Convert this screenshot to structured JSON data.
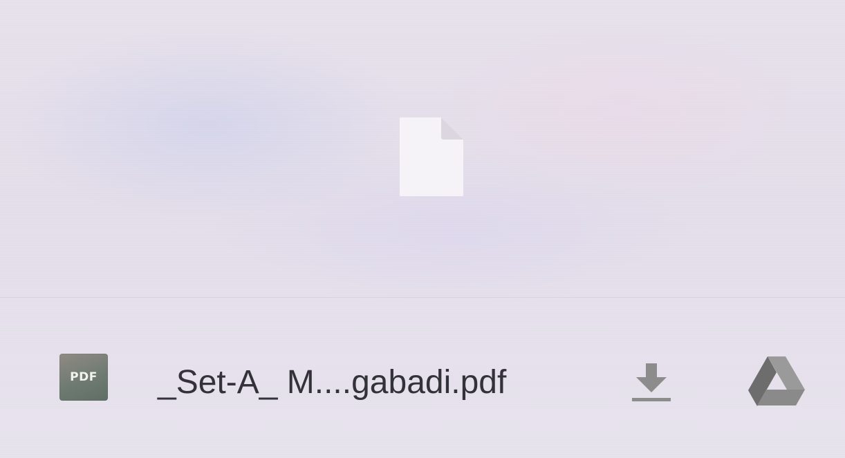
{
  "file": {
    "name": "_Set-A_ M....gabadi.pdf",
    "type_badge": "PDF"
  },
  "actions": {
    "download_icon": "download-icon",
    "drive_icon": "google-drive-icon"
  },
  "colors": {
    "background": "#e4deea",
    "text": "#323238",
    "icon_gray": "#8a8a8a",
    "placeholder_file": "#f4f2f6"
  }
}
